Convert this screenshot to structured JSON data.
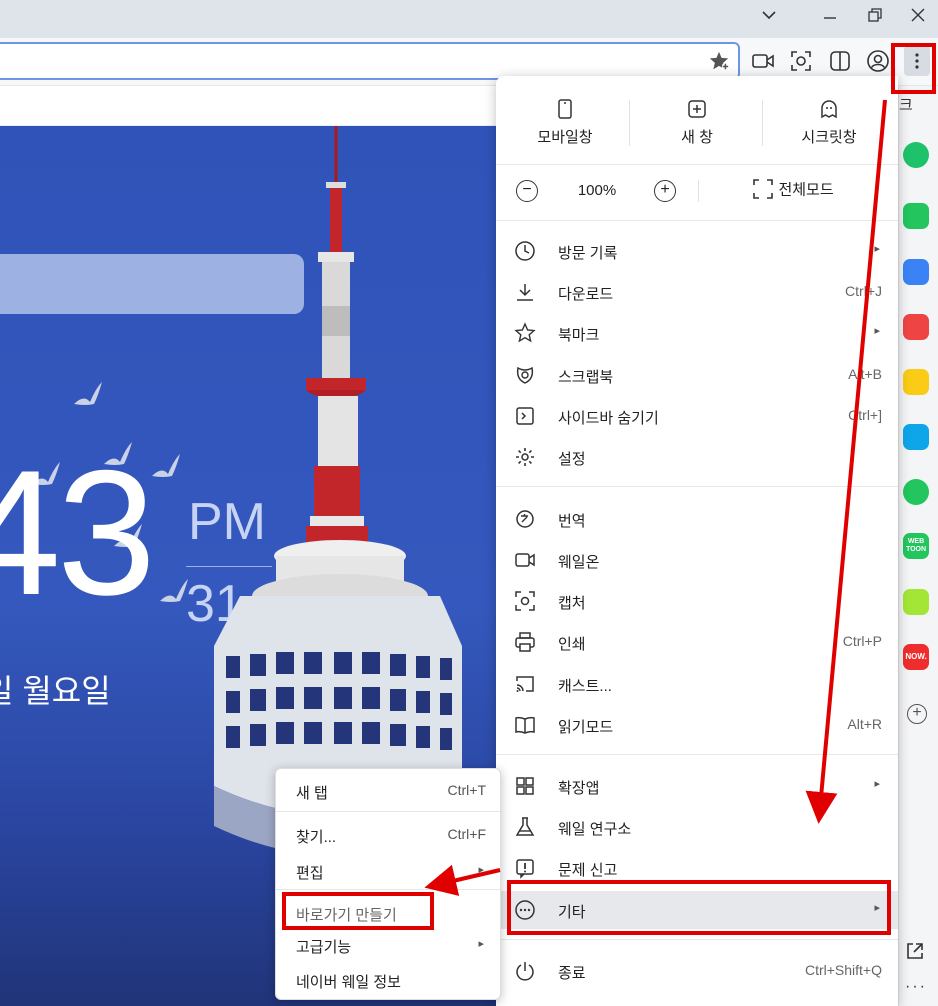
{
  "window": {
    "controls": [
      "chevron-down",
      "minimize",
      "restore",
      "close"
    ]
  },
  "sidebar_top_label": "크",
  "clock": {
    "big": "43",
    "ampm": "PM",
    "seconds": "31",
    "date": "일 월요일"
  },
  "menu": {
    "top_buttons": [
      {
        "label": "모바일창",
        "icon": "mobile-icon"
      },
      {
        "label": "새 창",
        "icon": "new-window-icon"
      },
      {
        "label": "시크릿창",
        "icon": "ghost-icon"
      }
    ],
    "zoom": {
      "value": "100%",
      "fullscreen_label": "전체모드"
    },
    "items": [
      {
        "label": "방문 기록",
        "shortcut": "",
        "arrow": "▸",
        "icon": "history-icon"
      },
      {
        "label": "다운로드",
        "shortcut": "Ctrl+J",
        "icon": "download-icon"
      },
      {
        "label": "북마크",
        "shortcut": "",
        "arrow": "▸",
        "icon": "star-icon"
      },
      {
        "label": "스크랩북",
        "shortcut": "Alt+B",
        "icon": "scrapbook-icon"
      },
      {
        "label": "사이드바 숨기기",
        "shortcut": "Ctrl+]",
        "icon": "sidebar-toggle-icon"
      },
      {
        "label": "설정",
        "shortcut": "",
        "icon": "gear-icon"
      },
      {
        "label": "번역",
        "shortcut": "",
        "icon": "translate-icon"
      },
      {
        "label": "웨일온",
        "shortcut": "",
        "icon": "whale-on-icon"
      },
      {
        "label": "캡처",
        "shortcut": "",
        "icon": "capture-icon"
      },
      {
        "label": "인쇄",
        "shortcut": "Ctrl+P",
        "icon": "print-icon"
      },
      {
        "label": "캐스트...",
        "shortcut": "",
        "icon": "cast-icon"
      },
      {
        "label": "읽기모드",
        "shortcut": "Alt+R",
        "icon": "book-icon"
      },
      {
        "label": "확장앱",
        "shortcut": "",
        "arrow": "▸",
        "icon": "extensions-icon"
      },
      {
        "label": "웨일 연구소",
        "shortcut": "",
        "icon": "flask-icon"
      },
      {
        "label": "문제 신고",
        "shortcut": "",
        "icon": "report-icon"
      },
      {
        "label": "기타",
        "shortcut": "",
        "arrow": "▸",
        "icon": "more-icon"
      },
      {
        "label": "종료",
        "shortcut": "Ctrl+Shift+Q",
        "icon": "power-icon"
      }
    ]
  },
  "submenu": {
    "items": [
      {
        "label": "새 탭",
        "shortcut": "Ctrl+T"
      },
      {
        "label": "찾기...",
        "shortcut": "Ctrl+F"
      },
      {
        "label": "편집",
        "shortcut": "",
        "arrow": "▸"
      },
      {
        "label": "바로가기 만들기",
        "shortcut": ""
      },
      {
        "label": "고급기능",
        "shortcut": "",
        "arrow": "▸"
      },
      {
        "label": "네이버 웨일 정보",
        "shortcut": ""
      }
    ]
  },
  "sidebar_apps": [
    {
      "name": "green-circle-app-icon",
      "color": "#1ec26a"
    },
    {
      "name": "bell-app-icon",
      "color": "#22c55e"
    },
    {
      "name": "briefcase-app-icon",
      "color": "#3b82f6"
    },
    {
      "name": "pocket-app-icon",
      "color": "#ef4444"
    },
    {
      "name": "star-app-icon",
      "color": "#facc15"
    },
    {
      "name": "translate-app-icon",
      "color": "#0ea5e9"
    },
    {
      "name": "play-app-icon",
      "color": "#22c55e"
    },
    {
      "name": "webtoon-app-icon",
      "color": "#22c55e",
      "text": "WEB TOON"
    },
    {
      "name": "memo-app-icon",
      "color": "#a3e635"
    },
    {
      "name": "now-app-icon",
      "color": "#ef2d2d",
      "text": "NOW."
    }
  ]
}
